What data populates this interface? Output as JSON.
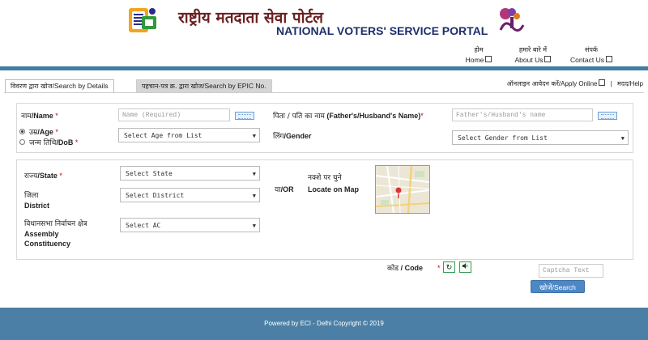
{
  "header": {
    "title_hindi": "राष्ट्रीय मतदाता सेवा पोर्टल",
    "title_english": "NATIONAL VOTERS' SERVICE PORTAL"
  },
  "nav": [
    {
      "hindi": "होम",
      "english": "Home"
    },
    {
      "hindi": "हमारे बारे में",
      "english": "About Us"
    },
    {
      "hindi": "संपर्क",
      "english": "Contact Us"
    }
  ],
  "tabs": [
    {
      "hindi": "विवरण द्वारा खोज",
      "english": "/Search by Details"
    },
    {
      "hindi": "पहचान-पत्र क्र. द्वारा खोज",
      "english": "/Search by EPIC No."
    }
  ],
  "top_links": {
    "apply_hindi": "ऑनलाइन आवेदन करें",
    "apply_english": "/Apply Online",
    "separator": "|",
    "help_hindi": "मदद",
    "help_english": "/Help"
  },
  "form": {
    "name_hindi": "नाम",
    "name_english": "/Name",
    "name_placeholder": "Name (Required)",
    "father_hindi": "पिता / पति का नाम",
    "father_english": " (Father's/Husband's Name)",
    "father_placeholder": "Father's/Husband's name",
    "age_hindi": "उम्र",
    "age_english": "/Age",
    "dob_hindi": "जन्म तिथि",
    "dob_english": "/DoB",
    "age_select": "Select Age from List",
    "gender_hindi": "लिंग",
    "gender_english": "/Gender",
    "gender_select": "Select Gender from List",
    "state_hindi": "राज्य",
    "state_english": "/State",
    "state_select": "Select State",
    "district_hindi": "जिला",
    "district_english": "District",
    "district_select": "Select District",
    "assembly_hindi": "विधानसभा निर्वाचन क्षेत्र",
    "assembly_english_1": "Assembly",
    "assembly_english_2": "Constituency",
    "ac_select": "Select AC",
    "or_hindi": "या",
    "or_english": "/OR",
    "map_hindi": "नक्शे पर चुने",
    "map_english": "Locate on Map",
    "required_mark": "*",
    "code_hindi": "कोड",
    "code_english": " / Code",
    "captcha_placeholder": "Captcha Text",
    "search_hindi": "खोजें",
    "search_english": "/Search"
  },
  "footer": {
    "text": "Powered by ECI - Delhi Copyright © 2019"
  },
  "icons": {
    "refresh": "refresh-icon",
    "audio": "speaker-icon",
    "external": "external-link-icon",
    "caret": "▼"
  },
  "colors": {
    "topbar": "#417ea2",
    "footer": "#4b7fa5",
    "title_hindi": "#6a1f1f",
    "title_english": "#1d2e6b",
    "button": "#4d88c5"
  }
}
